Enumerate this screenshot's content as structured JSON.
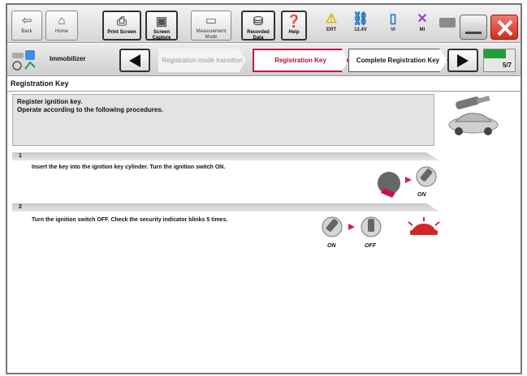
{
  "toolbar": {
    "buttons": [
      {
        "label": "Back",
        "icon": "back-arrow-icon"
      },
      {
        "label": "Home",
        "icon": "home-icon"
      },
      {
        "label": "Print Screen",
        "icon": "print-icon"
      },
      {
        "label": "Screen Capture",
        "icon": "camera-icon"
      },
      {
        "label": "Measurement Mode",
        "icon": "measurement-icon"
      },
      {
        "label": "Recorded Data",
        "icon": "recorded-data-icon"
      },
      {
        "label": "Help",
        "icon": "help-icon"
      }
    ],
    "status": [
      {
        "label": "ERT",
        "icon": "warning-icon"
      },
      {
        "label": "12.4V",
        "icon": "car-battery-icon"
      },
      {
        "label": "VI",
        "icon": "signal-icon"
      },
      {
        "label": "MI",
        "icon": "mi-x-icon"
      }
    ]
  },
  "breadcrumb": {
    "label": "Immobilizer",
    "steps": [
      {
        "label": "Registration mode transition",
        "state": "past"
      },
      {
        "label": "Registration Key",
        "state": "current"
      },
      {
        "label": "Complete Registration Key",
        "state": "next"
      }
    ],
    "progress": {
      "text": "5/7",
      "value": 0.714
    }
  },
  "page": {
    "title": "Registration Key",
    "instructions": [
      "Register ignition key.",
      "Operate according to the following procedures."
    ]
  },
  "steps": [
    {
      "number": "1",
      "text": "Insert the key into the ignition key cylinder. Turn the ignition switch ON.",
      "labels": [
        "ON"
      ]
    },
    {
      "number": "2",
      "text": "Turn the ignition switch OFF. Check the security indicator blinks 5 times.",
      "labels": [
        "ON",
        "OFF"
      ]
    }
  ],
  "colors": {
    "accent": "#c21846",
    "progress": "#1fa03a",
    "close": "#e0352b",
    "arrow": "#d81b5a"
  }
}
